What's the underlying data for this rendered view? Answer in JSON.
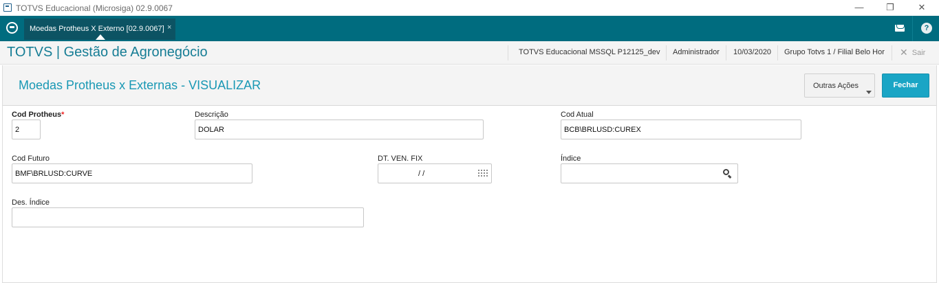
{
  "window": {
    "title": "TOTVS Educacional (Microsiga) 02.9.0067",
    "minimize": "—",
    "restore": "❐",
    "close": "✕"
  },
  "tabbar": {
    "tab_label": "Moedas Protheus X Externo [02.9.0067]",
    "tab_close": "×"
  },
  "header": {
    "brand": "TOTVS | Gestão de Agronegócio",
    "environment": "TOTVS Educacional MSSQL P12125_dev",
    "user": "Administrador",
    "date": "10/03/2020",
    "branch": "Grupo Totvs 1 / Filial Belo Hor",
    "logout_icon": "✕",
    "logout_label": "Sair"
  },
  "form": {
    "title": "Moedas Protheus x Externas - VISUALIZAR",
    "other_actions_label": "Outras Ações",
    "close_label": "Fechar",
    "fields": {
      "cod_protheus": {
        "label": "Cod Protheus",
        "required_mark": "*",
        "value": "2"
      },
      "descricao": {
        "label": "Descrição",
        "value": "DOLAR"
      },
      "cod_atual": {
        "label": "Cod Atual",
        "value": "BCB\\BRLUSD:CUREX"
      },
      "cod_futuro": {
        "label": "Cod Futuro",
        "value": "BMF\\BRLUSD:CURVE"
      },
      "dt_ven_fix": {
        "label": "DT. VEN. FIX",
        "value": "/ /"
      },
      "indice": {
        "label": "Índice",
        "value": ""
      },
      "des_indice": {
        "label": "Des. Índice",
        "value": ""
      }
    }
  }
}
